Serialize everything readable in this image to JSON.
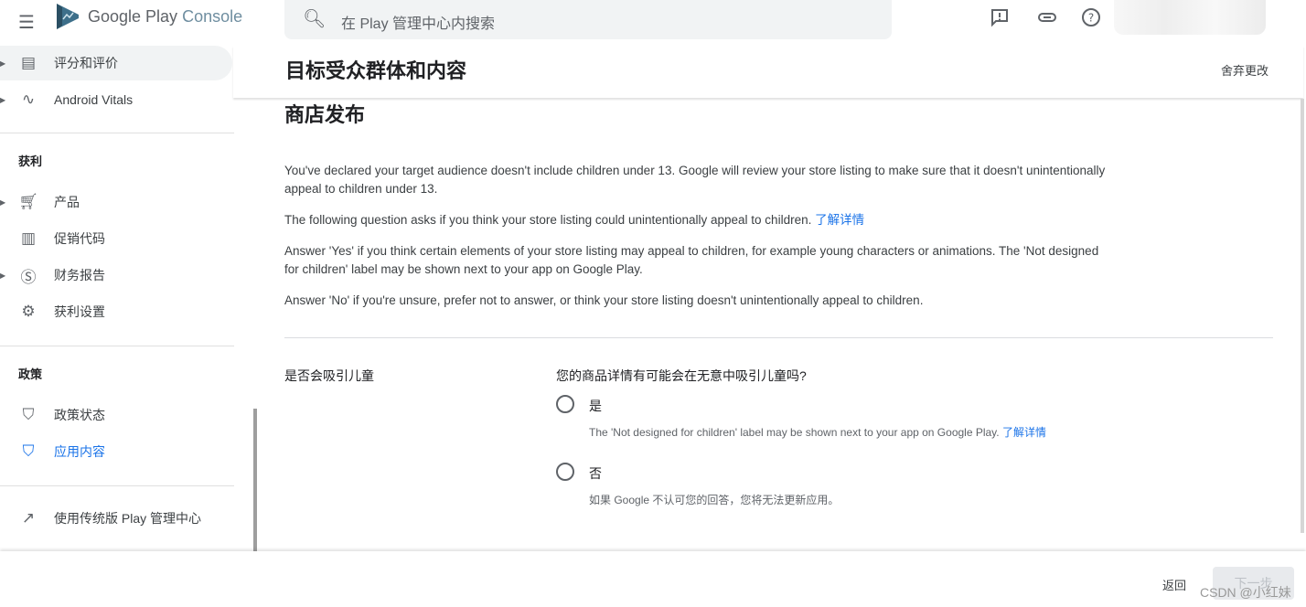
{
  "app": {
    "brand_main": "Google Play",
    "brand_sub": "Console"
  },
  "search": {
    "placeholder": "在 Play 管理中心内搜索"
  },
  "header": {
    "title": "目标受众群体和内容",
    "discard": "舍弃更改"
  },
  "sidebar": {
    "items_top": [
      {
        "label": "评分和评价",
        "icon": "rating-icon"
      },
      {
        "label": "Android Vitals",
        "icon": "vitals-icon"
      }
    ],
    "section_monetize": "获利",
    "items_monetize": [
      {
        "label": "产品",
        "icon": "cart-icon"
      },
      {
        "label": "促销代码",
        "icon": "store-icon"
      },
      {
        "label": "财务报告",
        "icon": "dollar-icon"
      },
      {
        "label": "获利设置",
        "icon": "gear-icon"
      }
    ],
    "section_policy": "政策",
    "items_policy": [
      {
        "label": "政策状态",
        "icon": "shield-icon"
      },
      {
        "label": "应用内容",
        "icon": "shield-info-icon",
        "active": true
      }
    ],
    "legacy": "使用传统版 Play 管理中心"
  },
  "main": {
    "section_title": "商店发布",
    "p1": "You've declared your target audience doesn't include children under 13. Google will review your store listing to make sure that it doesn't unintentionally appeal to children under 13.",
    "p2": "The following question asks if you think your store listing could unintentionally appeal to children.",
    "p2_link": "了解详情",
    "p3": "Answer 'Yes' if you think certain elements of your store listing may appeal to children, for example young characters or animations. The 'Not designed for children' label may be shown next to your app on Google Play.",
    "p4": "Answer 'No' if you're unsure, prefer not to answer, or think your store listing doesn't unintentionally appeal to children.",
    "field_label": "是否会吸引儿童",
    "question": "您的商品详情有可能会在无意中吸引儿童吗?",
    "options": [
      {
        "label": "是",
        "desc": "The 'Not designed for children' label may be shown next to your app on Google Play.",
        "link": "了解详情",
        "selected": false
      },
      {
        "label": "否",
        "desc": "如果 Google 不认可您的回答，您将无法更新应用。",
        "selected": false
      }
    ]
  },
  "footer": {
    "back": "返回",
    "next": "下一步"
  },
  "watermark": "CSDN @小红妹"
}
